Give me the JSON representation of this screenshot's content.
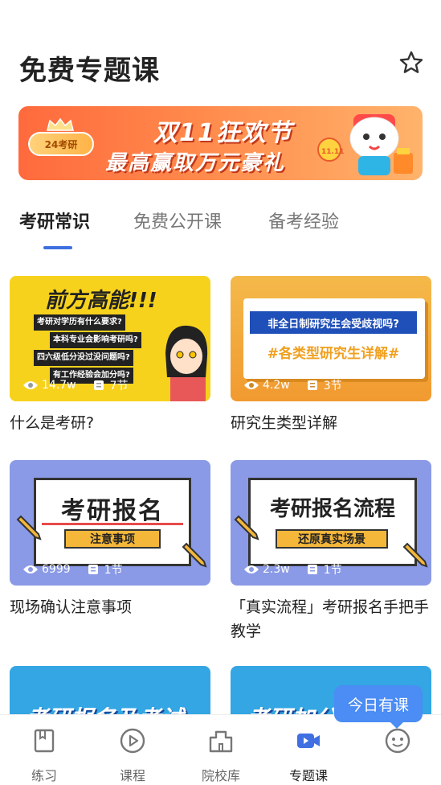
{
  "page": {
    "title": "免费专题课"
  },
  "banner": {
    "badge": "24考研",
    "line1": "双11狂欢节",
    "line2": "最高赢取万元豪礼",
    "mascot_badge": "11.11"
  },
  "tabs": [
    {
      "label": "考研常识",
      "active": true
    },
    {
      "label": "免费公开课",
      "active": false
    },
    {
      "label": "备考经验",
      "active": false
    }
  ],
  "cards": [
    {
      "title": "什么是考研?",
      "views": "14.7w",
      "lessons": "7节",
      "thumb": {
        "heading": "前方高能!!!",
        "questions": [
          "考研对学历有什么要求?",
          "本科专业会影响考研吗?",
          "四六级低分没过没问题吗?",
          "有工作经验会加分吗?"
        ]
      }
    },
    {
      "title": "研究生类型详解",
      "views": "4.2w",
      "lessons": "3节",
      "thumb": {
        "heading": "非全日制研究生会受歧视吗?",
        "sub": "#各类型研究生详解#"
      }
    },
    {
      "title": "现场确认注意事项",
      "views": "6999",
      "lessons": "1节",
      "thumb": {
        "heading": "考研报名",
        "sub": "注意事项"
      }
    },
    {
      "title": "「真实流程」考研报名手把手教学",
      "views": "2.3w",
      "lessons": "1节",
      "thumb": {
        "heading": "考研报名流程",
        "sub": "还原真实场景"
      }
    },
    {
      "title": "",
      "thumb": {
        "heading": "考研报名及考试"
      }
    },
    {
      "title": "",
      "thumb": {
        "heading": "考研加分"
      }
    }
  ],
  "floating": {
    "today_label": "今日有课"
  },
  "tabbar": [
    {
      "label": "练习",
      "icon": "book-icon"
    },
    {
      "label": "课程",
      "icon": "play-circle-icon"
    },
    {
      "label": "院校库",
      "icon": "building-icon"
    },
    {
      "label": "专题课",
      "icon": "video-icon",
      "active": true
    },
    {
      "label": "",
      "icon": "face-icon"
    }
  ],
  "colors": {
    "accent": "#3f6fe0",
    "bubble": "#4b8cf5",
    "banner": "#ff6a3d"
  }
}
